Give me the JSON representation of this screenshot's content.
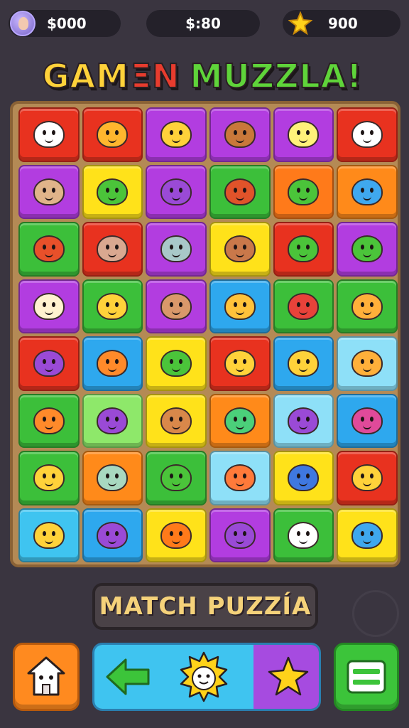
{
  "hud": {
    "coins": "$000",
    "cash": "$:80",
    "stars": "900"
  },
  "title": {
    "word1": "GAM",
    "word2": "ΞN",
    "word3": "MUZZLA!"
  },
  "board": {
    "rows": [
      [
        {
          "bg": "#e8321f",
          "fg": "#ffffff"
        },
        {
          "bg": "#e8321f",
          "fg": "#ffb62e"
        },
        {
          "bg": "#b23de0",
          "fg": "#ffd23a"
        },
        {
          "bg": "#b23de0",
          "fg": "#c9783a"
        },
        {
          "bg": "#b23de0",
          "fg": "#fff27a"
        },
        {
          "bg": "#e8321f",
          "fg": "#ffffff"
        }
      ],
      [
        {
          "bg": "#b23de0",
          "fg": "#e0b48a"
        },
        {
          "bg": "#ffe21a",
          "fg": "#4bc43a"
        },
        {
          "bg": "#b23de0",
          "fg": "#9a4ad6"
        },
        {
          "bg": "#3cbf3a",
          "fg": "#e0532a"
        },
        {
          "bg": "#ff7a1a",
          "fg": "#4bc43a"
        },
        {
          "bg": "#ff8a1a",
          "fg": "#3fa8ee"
        }
      ],
      [
        {
          "bg": "#3cbf3a",
          "fg": "#e8502a"
        },
        {
          "bg": "#e8321f",
          "fg": "#d9a890"
        },
        {
          "bg": "#b23de0",
          "fg": "#a8c8c8"
        },
        {
          "bg": "#ffe21a",
          "fg": "#c9784a"
        },
        {
          "bg": "#e8321f",
          "fg": "#4bc43a"
        },
        {
          "bg": "#b23de0",
          "fg": "#4bc43a"
        }
      ],
      [
        {
          "bg": "#b23de0",
          "fg": "#fff2d0"
        },
        {
          "bg": "#3cbf3a",
          "fg": "#ffd23a"
        },
        {
          "bg": "#b23de0",
          "fg": "#d9986a"
        },
        {
          "bg": "#2ea8ee",
          "fg": "#ffc23a"
        },
        {
          "bg": "#3cbf3a",
          "fg": "#e8423a"
        },
        {
          "bg": "#3cbf3a",
          "fg": "#ffb03a"
        }
      ],
      [
        {
          "bg": "#e8321f",
          "fg": "#9a4ad6"
        },
        {
          "bg": "#2ea8ee",
          "fg": "#ff8a2a"
        },
        {
          "bg": "#ffe21a",
          "fg": "#4bc43a"
        },
        {
          "bg": "#e8321f",
          "fg": "#ffd23a"
        },
        {
          "bg": "#2ea8ee",
          "fg": "#ffd23a"
        },
        {
          "bg": "#8ee0f8",
          "fg": "#ffb03a"
        }
      ],
      [
        {
          "bg": "#3cbf3a",
          "fg": "#ff8a2a"
        },
        {
          "bg": "#8ee86a",
          "fg": "#9a4ad6"
        },
        {
          "bg": "#ffe21a",
          "fg": "#d9884a"
        },
        {
          "bg": "#ff8a1a",
          "fg": "#4bd07a"
        },
        {
          "bg": "#8ee0f8",
          "fg": "#9a4ad6"
        },
        {
          "bg": "#2ea8ee",
          "fg": "#e04a9a"
        }
      ],
      [
        {
          "bg": "#3cbf3a",
          "fg": "#ffd23a"
        },
        {
          "bg": "#ff8a1a",
          "fg": "#a8d8c0"
        },
        {
          "bg": "#3cbf3a",
          "fg": "#4bc43a"
        },
        {
          "bg": "#8ee0f8",
          "fg": "#ff7a3a"
        },
        {
          "bg": "#ffe21a",
          "fg": "#3f78e0"
        },
        {
          "bg": "#e8321f",
          "fg": "#ffd23a"
        }
      ],
      [
        {
          "bg": "#3fc4f0",
          "fg": "#ffd23a"
        },
        {
          "bg": "#2ea8ee",
          "fg": "#9a4ad6"
        },
        {
          "bg": "#ffe21a",
          "fg": "#ff7a1a"
        },
        {
          "bg": "#b23de0",
          "fg": "#9a4ad6"
        },
        {
          "bg": "#3cbf3a",
          "fg": "#ffffff"
        },
        {
          "bg": "#ffe21a",
          "fg": "#3fa8ee"
        }
      ]
    ]
  },
  "match_label": "MATCH PUZZÍA",
  "controls": {
    "home_icon": "house-icon",
    "back_icon": "arrow-left-icon",
    "center_icon": "sun-creature-icon",
    "next_icon": "star-icon",
    "menu_icon": "menu-icon"
  }
}
